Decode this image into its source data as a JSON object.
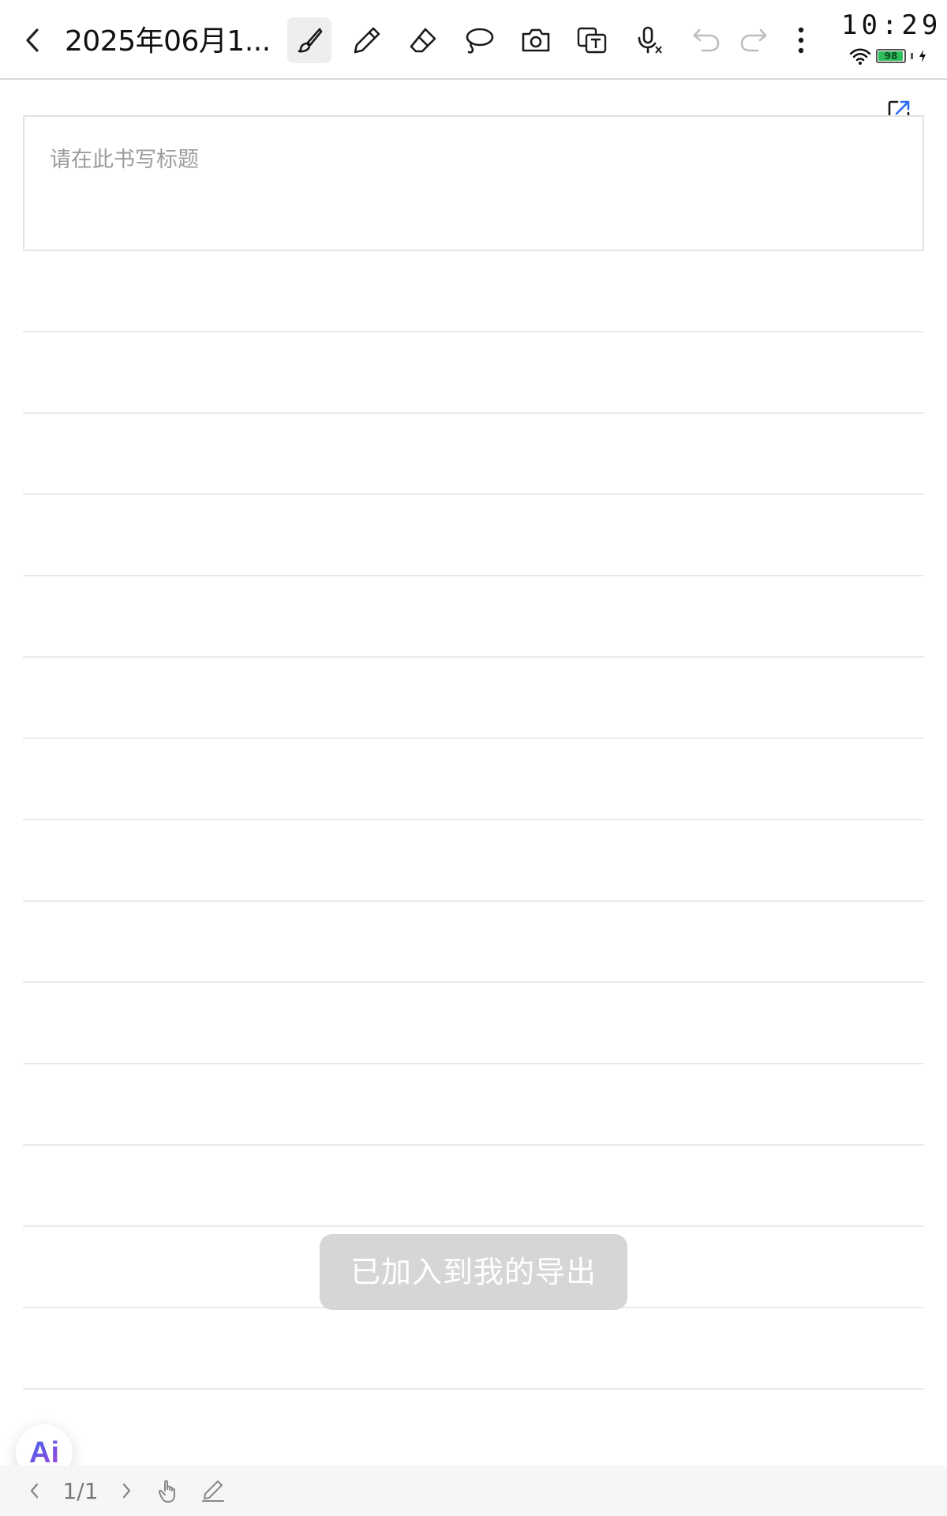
{
  "toolbar": {
    "title": "2025年06月1...",
    "tools": [
      {
        "icon": "brush-icon",
        "active": true
      },
      {
        "icon": "pen-icon",
        "active": false
      },
      {
        "icon": "eraser-icon",
        "active": false
      },
      {
        "icon": "lasso-icon",
        "active": false
      },
      {
        "icon": "camera-icon",
        "active": false
      },
      {
        "icon": "text-recognition-icon",
        "active": false
      },
      {
        "icon": "voice-to-text-icon",
        "active": false
      },
      {
        "icon": "undo-icon",
        "active": false
      },
      {
        "icon": "redo-icon",
        "active": false
      },
      {
        "icon": "more-icon",
        "active": false
      }
    ]
  },
  "status": {
    "time": "10:29",
    "battery_level": "98",
    "battery_fill": 0.98,
    "charging": true,
    "wifi": true,
    "battery_color": "#2ebd5a"
  },
  "note": {
    "title_placeholder": "请在此书写标题",
    "ruled_lines": 14
  },
  "toast": {
    "message": "已加入到我的导出"
  },
  "ai_button": {
    "label": "Ai"
  },
  "bottom_bar": {
    "page_indicator": "1/1"
  }
}
